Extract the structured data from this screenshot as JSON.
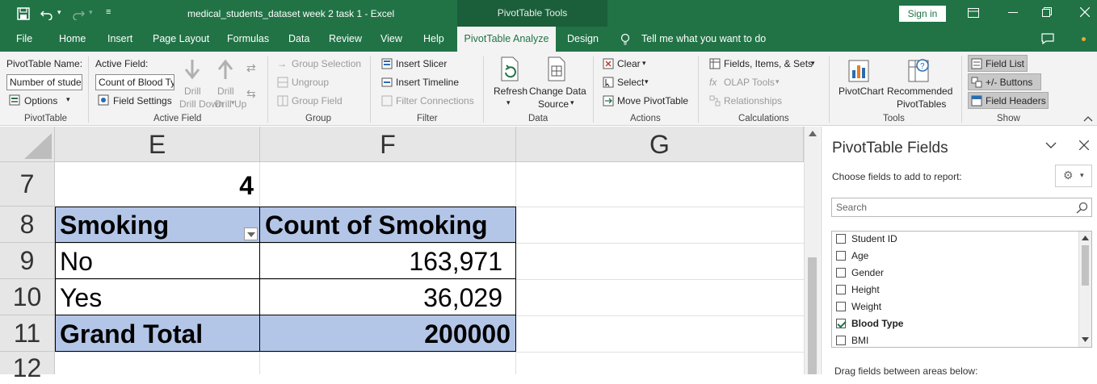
{
  "titlebar": {
    "save_icon": "save-icon",
    "undo_icon": "undo-icon",
    "redo_icon": "redo-icon",
    "customize_icon": "customize-qat-icon",
    "doc_title": "medical_students_dataset week 2 task 1  -  Excel",
    "context_label": "PivotTable Tools",
    "signin": "Sign in"
  },
  "menu": {
    "tabs": [
      "File",
      "Home",
      "Insert",
      "Page Layout",
      "Formulas",
      "Data",
      "Review",
      "View",
      "Help",
      "PivotTable Analyze",
      "Design"
    ],
    "tell_me": "Tell me what you want to do"
  },
  "ribbon": {
    "pivottable": {
      "name_label": "PivotTable Name:",
      "name_value": "Number of students",
      "options": "Options",
      "group": "PivotTable"
    },
    "active_field": {
      "label": "Active Field:",
      "value": "Count of Blood Type",
      "settings": "Field Settings",
      "drill_down": "Drill Down",
      "drill_up": "Drill Up",
      "group": "Active Field"
    },
    "group_grp": {
      "group_selection": "Group Selection",
      "ungroup": "Ungroup",
      "group_field": "Group Field",
      "group": "Group"
    },
    "filter": {
      "insert_slicer": "Insert Slicer",
      "insert_timeline": "Insert Timeline",
      "filter_connections": "Filter Connections",
      "group": "Filter"
    },
    "data": {
      "refresh": "Refresh",
      "change_source_1": "Change Data",
      "change_source_2": "Source",
      "group": "Data"
    },
    "actions": {
      "clear": "Clear",
      "select": "Select",
      "move": "Move PivotTable",
      "group": "Actions"
    },
    "calculations": {
      "fields": "Fields, Items, & Sets",
      "olap": "OLAP Tools",
      "relationships": "Relationships",
      "group": "Calculations"
    },
    "tools": {
      "pivotchart": "PivotChart",
      "recommended_1": "Recommended",
      "recommended_2": "PivotTables",
      "group": "Tools"
    },
    "show": {
      "field_list": "Field List",
      "buttons": "+/- Buttons",
      "headers": "Field Headers",
      "group": "Show"
    }
  },
  "grid": {
    "columns": [
      "E",
      "F",
      "G"
    ],
    "rows": [
      "7",
      "8",
      "9",
      "10",
      "11",
      "12"
    ],
    "cells": {
      "e7": "4",
      "e8": "Smoking",
      "f8": "Count of Smoking",
      "e9": "No",
      "f9": "163,971",
      "e10": "Yes",
      "f10": "36,029",
      "e11": "Grand Total",
      "f11": "200000"
    },
    "header_fill": "#b4c6e7"
  },
  "panel": {
    "title": "PivotTable Fields",
    "choose": "Choose fields to add to report:",
    "search_placeholder": "Search",
    "fields": [
      {
        "name": "Student ID",
        "checked": false
      },
      {
        "name": "Age",
        "checked": false
      },
      {
        "name": "Gender",
        "checked": false
      },
      {
        "name": "Height",
        "checked": false
      },
      {
        "name": "Weight",
        "checked": false
      },
      {
        "name": "Blood Type",
        "checked": true
      },
      {
        "name": "BMI",
        "checked": false
      }
    ],
    "drag_hint": "Drag fields between areas below:"
  }
}
